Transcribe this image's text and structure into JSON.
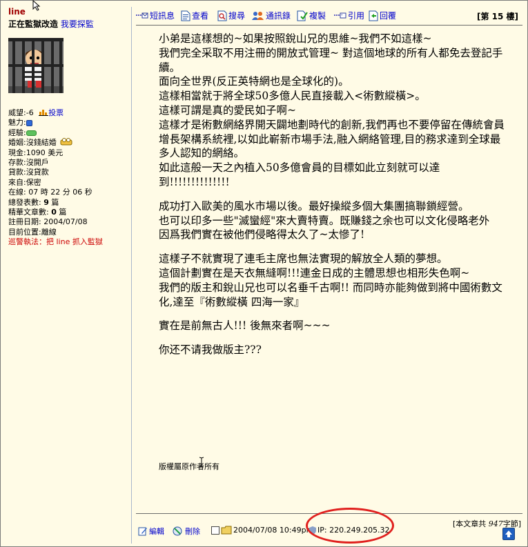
{
  "user": {
    "name": "line",
    "status_prefix": "正在監獄改造",
    "status_link": "我要探監"
  },
  "stats": {
    "reputation_label": "威望:",
    "reputation_value": "-6",
    "vote_link": "投票",
    "charm_label": "魅力:",
    "exp_label": "經驗:",
    "marriage_label": "婚姻:",
    "marriage_value": "沒錢結婚",
    "cash_label": "現金:",
    "cash_value": "1090 美元",
    "deposit_label": "存款:",
    "deposit_value": "沒開戶",
    "loan_label": "貸款:",
    "loan_value": "沒貸款",
    "from_label": "來自:",
    "from_value": "保密",
    "online_label": "在線:",
    "online_value": "07 時 22 分 06 秒",
    "posts_label": "總發表數:",
    "posts_value": "9",
    "posts_unit": "篇",
    "elite_label": "精華文章數:",
    "elite_value": "0",
    "elite_unit": "篇",
    "reg_label": "註冊日期:",
    "reg_value": "2004/07/08",
    "location_label": "目前位置:",
    "location_value": "離線",
    "police": "巡警執法：把 line 抓入監獄"
  },
  "toolbar": {
    "sms": "短訊息",
    "view": "查看",
    "search": "搜尋",
    "contacts": "通訊錄",
    "copy": "複製",
    "quote": "引用",
    "reply": "回覆",
    "floor": "[第 15 樓]"
  },
  "post": {
    "paragraphs": [
      "小弟是這樣想的~如果按照銳山兄的思維~我們不如這樣~\n我們完全采取不用注冊的開放式管理~ 對這個地球的所有人都免去登記手續。\n面向全世界(反正英特網也是全球化的)。\n這樣相當就于將全球50多億人民直接載入<術數縱橫>。\n這樣可謂是真的愛民如子啊~\n這樣才是術數網絡界開天闢地劃時代的創新,我們再也不要停留在傳統會員增長架構系統裡,以如此嶄新市場手法,融入網絡管理,目的務求達到全球最多人認知的網絡。\n如此這般一天之內植入50多億會員的目標如此立刻就可以達到!!!!!!!!!!!!!!",
      "成功打入歐美的風水市場以後。最好操縱多個大集團搞聯鎖經營。\n也可以印多一些\"滅蠻經\"來大賣特賣。既賺錢之余也可以文化侵略老外\n因爲我們實在被他們侵略得太久了~太慘了!",
      "這樣子不就實現了連毛主席也無法實現的解放全人類的夢想。\n這個計劃實在是天衣無縫啊!!!連金日成的主體思想也相形失色啊~\n我們的版主和銳山兄也可以名垂千古啊!! 而同時亦能夠做到將中國術數文化,達至『術數縱橫 四海一家』",
      "實在是前無古人!!! 後無來者啊~~~",
      "你还不请我做版主???"
    ],
    "copyright": "版權屬原作者所有"
  },
  "footer": {
    "edit": "編輯",
    "delete": "刪除",
    "datetime": "2004/07/08 10:49pm",
    "ip": "IP: 220.249.205.32",
    "wordcount_prefix": "[本文章共",
    "wordcount_value": "947",
    "wordcount_suffix": "字節]"
  }
}
